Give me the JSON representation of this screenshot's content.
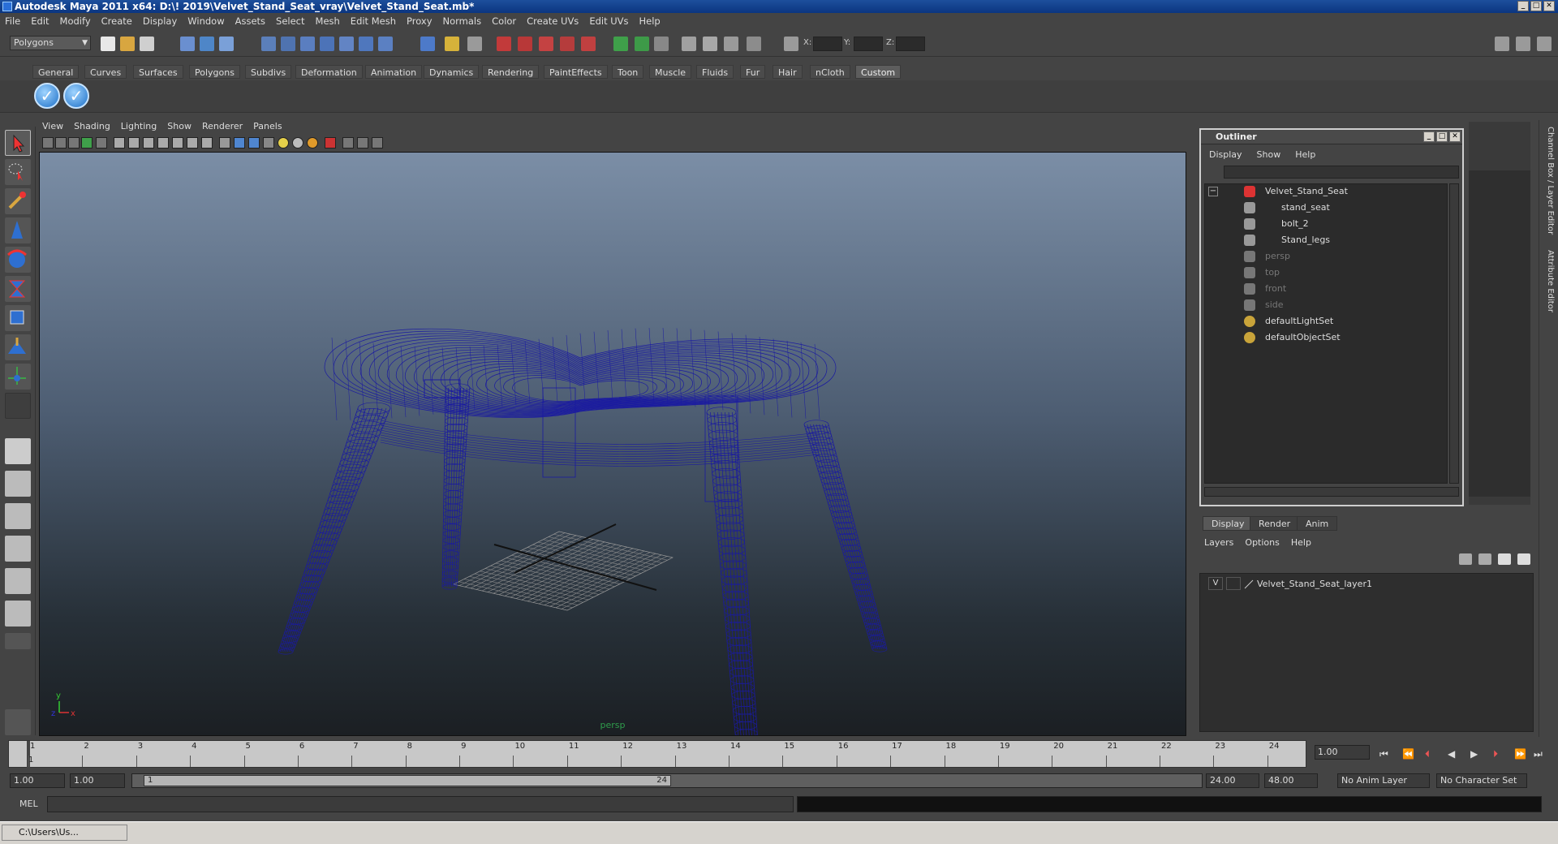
{
  "window": {
    "title": "Autodesk Maya 2011 x64: D:\\! 2019\\Velvet_Stand_Seat_vray\\Velvet_Stand_Seat.mb*"
  },
  "menubar": [
    "File",
    "Edit",
    "Modify",
    "Create",
    "Display",
    "Window",
    "Assets",
    "Select",
    "Mesh",
    "Edit Mesh",
    "Proxy",
    "Normals",
    "Color",
    "Create UVs",
    "Edit UVs",
    "Help"
  ],
  "statusline": {
    "menuset": "Polygons",
    "x_label": "X:",
    "y_label": "Y:",
    "z_label": "Z:"
  },
  "shelf": {
    "tabs": [
      "General",
      "Curves",
      "Surfaces",
      "Polygons",
      "Subdivs",
      "Deformation",
      "Animation",
      "Dynamics",
      "Rendering",
      "PaintEffects",
      "Toon",
      "Muscle",
      "Fluids",
      "Fur",
      "Hair",
      "nCloth",
      "Custom"
    ],
    "active_tab": "Custom"
  },
  "viewport": {
    "menu": [
      "View",
      "Shading",
      "Lighting",
      "Show",
      "Renderer",
      "Panels"
    ],
    "camera": "persp",
    "axis_x": "x",
    "axis_y": "y",
    "axis_z": "z",
    "wire_color": "#1a1aa0"
  },
  "outliner": {
    "title": "Outliner",
    "menu": [
      "Display",
      "Show",
      "Help"
    ],
    "collapse_glyph": "−",
    "items": [
      {
        "label": "Velvet_Stand_Seat",
        "dim": false
      },
      {
        "label": "stand_seat",
        "dim": false
      },
      {
        "label": "bolt_2",
        "dim": false
      },
      {
        "label": "Stand_legs",
        "dim": false
      },
      {
        "label": "persp",
        "dim": true
      },
      {
        "label": "top",
        "dim": true
      },
      {
        "label": "front",
        "dim": true
      },
      {
        "label": "side",
        "dim": true
      },
      {
        "label": "defaultLightSet",
        "dim": false
      },
      {
        "label": "defaultObjectSet",
        "dim": false
      }
    ]
  },
  "right_panel": {
    "channel_box_tab": "Channel Box / Layer Editor",
    "attribute_editor_tab": "Attribute Editor",
    "header": "Channel Box / Layer Editor"
  },
  "layer_editor": {
    "tabs": [
      "Display",
      "Render",
      "Anim"
    ],
    "active_tab": "Display",
    "menu": [
      "Layers",
      "Options",
      "Help"
    ],
    "layer": {
      "visibility": "V",
      "name": "Velvet_Stand_Seat_layer1"
    }
  },
  "timeline": {
    "ticks": [
      "1",
      "2",
      "3",
      "4",
      "5",
      "6",
      "7",
      "8",
      "9",
      "10",
      "11",
      "12",
      "13",
      "14",
      "15",
      "16",
      "17",
      "18",
      "19",
      "20",
      "21",
      "22",
      "23",
      "24"
    ],
    "current_marker": "1",
    "current_frame": "1.00"
  },
  "range": {
    "start_time": "1.00",
    "playback_start": "1.00",
    "slider_start": "1",
    "slider_end": "24",
    "playback_end": "24.00",
    "end_time": "48.00",
    "anim_layer": "No Anim Layer",
    "character_set": "No Character Set"
  },
  "command_line": {
    "label": "MEL"
  },
  "taskbar": {
    "item": "C:\\Users\\Us..."
  }
}
